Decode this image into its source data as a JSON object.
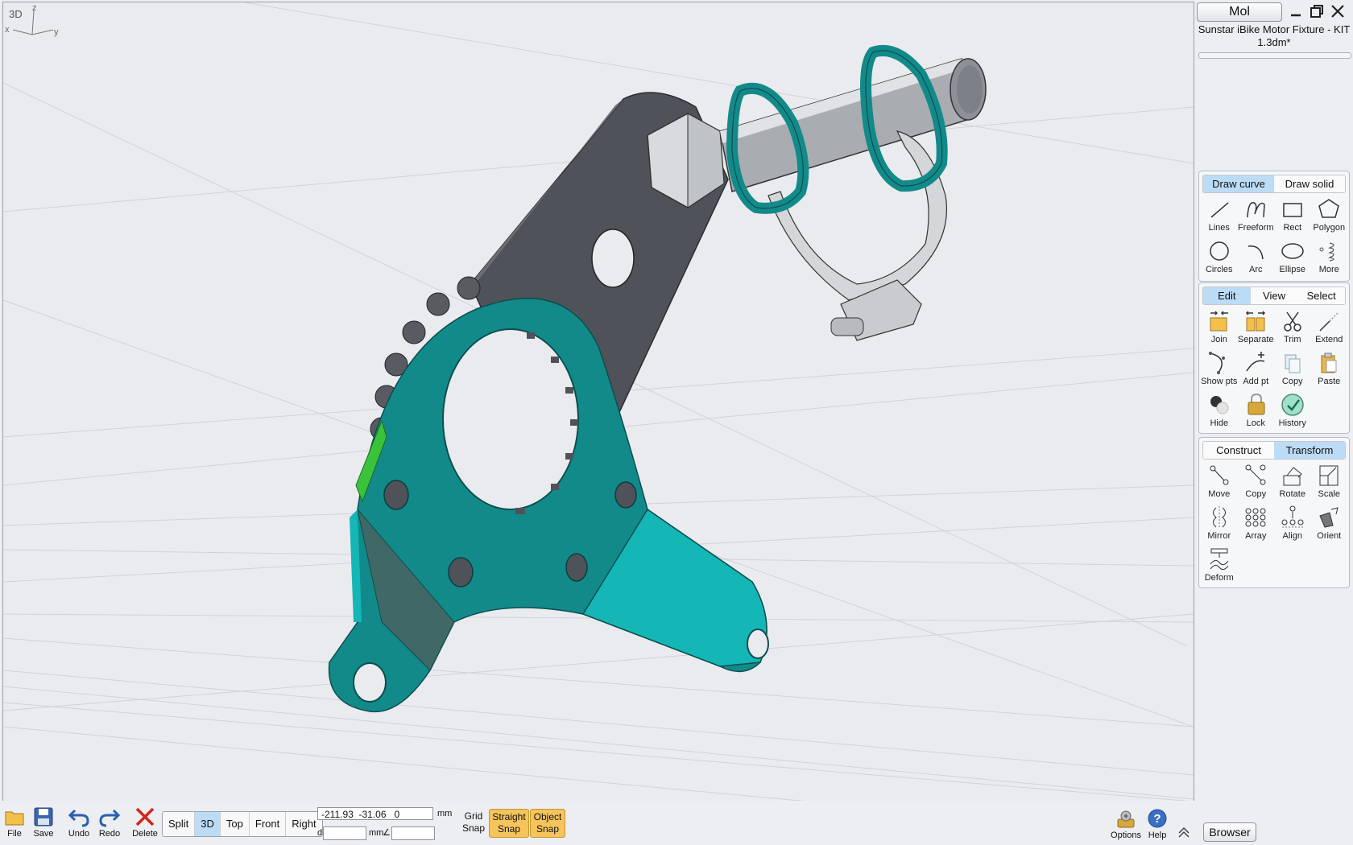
{
  "viewport": {
    "label": "3D",
    "axes": {
      "x": "x",
      "y": "y",
      "z": "z"
    }
  },
  "sidebar": {
    "app_button": "Mol",
    "window_controls": {
      "minimize": "minimize-icon",
      "restore": "restore-icon",
      "close": "close-icon"
    },
    "document_title": "Sunstar iBike Motor Fixture - KIT 1.3dm*",
    "draw_panel": {
      "tabs": [
        {
          "label": "Draw curve",
          "active": true
        },
        {
          "label": "Draw solid",
          "active": false
        }
      ],
      "tools": [
        {
          "label": "Lines",
          "icon": "line-icon"
        },
        {
          "label": "Freeform",
          "icon": "freeform-icon"
        },
        {
          "label": "Rect",
          "icon": "rectangle-icon"
        },
        {
          "label": "Polygon",
          "icon": "polygon-icon"
        },
        {
          "label": "Circles",
          "icon": "circle-icon"
        },
        {
          "label": "Arc",
          "icon": "arc-icon"
        },
        {
          "label": "Ellipse",
          "icon": "ellipse-icon"
        },
        {
          "label": "More",
          "icon": "more-icon"
        }
      ]
    },
    "edit_panel": {
      "tabs": [
        {
          "label": "Edit",
          "active": true
        },
        {
          "label": "View",
          "active": false
        },
        {
          "label": "Select",
          "active": false
        }
      ],
      "tools": [
        {
          "label": "Join",
          "icon": "join-icon"
        },
        {
          "label": "Separate",
          "icon": "separate-icon"
        },
        {
          "label": "Trim",
          "icon": "scissors-icon"
        },
        {
          "label": "Extend",
          "icon": "extend-icon"
        },
        {
          "label": "Show pts",
          "icon": "show-points-icon"
        },
        {
          "label": "Add pt",
          "icon": "add-point-icon"
        },
        {
          "label": "Copy",
          "icon": "copy-icon"
        },
        {
          "label": "Paste",
          "icon": "paste-icon"
        },
        {
          "label": "Hide",
          "icon": "hide-icon"
        },
        {
          "label": "Lock",
          "icon": "lock-icon"
        },
        {
          "label": "History",
          "icon": "history-icon"
        }
      ]
    },
    "transform_panel": {
      "tabs": [
        {
          "label": "Construct",
          "active": false
        },
        {
          "label": "Transform",
          "active": true
        }
      ],
      "tools": [
        {
          "label": "Move",
          "icon": "move-icon"
        },
        {
          "label": "Copy",
          "icon": "transform-copy-icon"
        },
        {
          "label": "Rotate",
          "icon": "rotate-icon"
        },
        {
          "label": "Scale",
          "icon": "scale-icon"
        },
        {
          "label": "Mirror",
          "icon": "mirror-icon"
        },
        {
          "label": "Array",
          "icon": "array-icon"
        },
        {
          "label": "Align",
          "icon": "align-icon"
        },
        {
          "label": "Orient",
          "icon": "orient-icon"
        },
        {
          "label": "Deform",
          "icon": "deform-icon"
        }
      ]
    }
  },
  "bottombar": {
    "file_buttons": [
      {
        "label": "File",
        "icon": "folder-icon"
      },
      {
        "label": "Save",
        "icon": "save-icon"
      },
      {
        "label": "Undo",
        "icon": "undo-icon"
      },
      {
        "label": "Redo",
        "icon": "redo-icon"
      },
      {
        "label": "Delete",
        "icon": "delete-icon"
      }
    ],
    "view_tabs": [
      {
        "label": "Split",
        "active": false
      },
      {
        "label": "3D",
        "active": true
      },
      {
        "label": "Top",
        "active": false
      },
      {
        "label": "Front",
        "active": false
      },
      {
        "label": "Right",
        "active": false
      }
    ],
    "coordinates": "-211.93  -31.06   0",
    "coord_unit": "mm",
    "distance_prefix": "d",
    "distance_unit": "mm",
    "angle_symbol": "∠",
    "grid_snap": {
      "line1": "Grid",
      "line2": "Snap",
      "on": false
    },
    "straight_snap": {
      "line1": "Straight",
      "line2": "Snap",
      "on": true
    },
    "object_snap": {
      "line1": "Object",
      "line2": "Snap",
      "on": true
    },
    "options_label": "Options",
    "help_label": "Help",
    "browser_label": "Browser"
  },
  "colors": {
    "teal": "#138a8a",
    "teal_light": "#12b8b8",
    "plate_gray": "#4f5258",
    "accent_active": "#bcdcf6",
    "snap_on": "#f6c45c"
  }
}
